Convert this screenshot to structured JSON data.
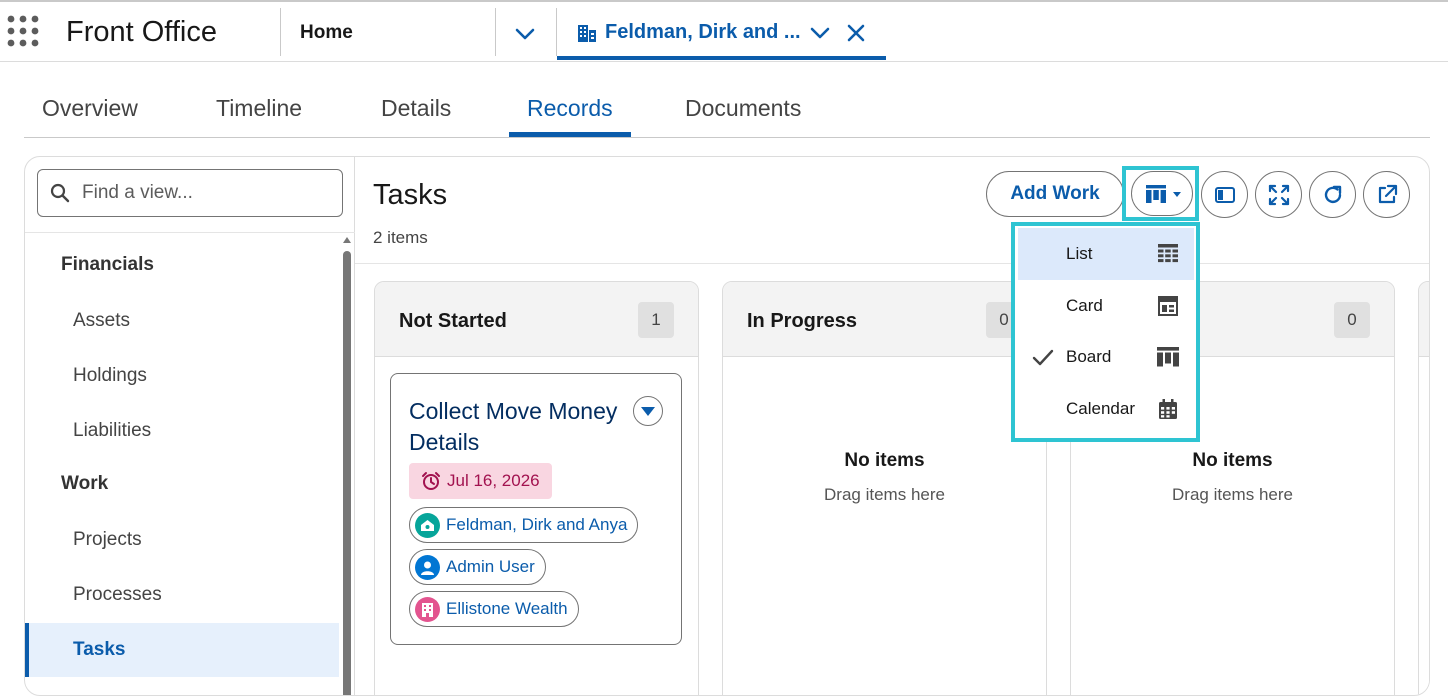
{
  "app": {
    "name": "Front Office",
    "nav_home": "Home",
    "active_tab_label": "Feldman, Dirk and ..."
  },
  "record_tabs": [
    "Overview",
    "Timeline",
    "Details",
    "Records",
    "Documents"
  ],
  "active_record_tab": "Records",
  "sidebar": {
    "search_placeholder": "Find a view...",
    "groups": [
      {
        "label": "Financials",
        "items": [
          "Assets",
          "Holdings",
          "Liabilities"
        ]
      },
      {
        "label": "Work",
        "items": [
          "Projects",
          "Processes",
          "Tasks"
        ]
      }
    ],
    "active_item": "Tasks"
  },
  "content": {
    "title": "Tasks",
    "count_label": "2 items",
    "add_button": "Add Work"
  },
  "columns": [
    {
      "title": "Not Started",
      "count": "1"
    },
    {
      "title": "In Progress",
      "count": "0",
      "empty_title": "No items",
      "empty_sub": "Drag items here"
    },
    {
      "title": "",
      "count": "0",
      "empty_title": "No items",
      "empty_sub": "Drag items here"
    }
  ],
  "task_card": {
    "title": "Collect Move Money Details",
    "due_date": "Jul 16, 2026",
    "related": [
      {
        "label": "Feldman, Dirk and Anya",
        "icon": "household-icon",
        "color": "#06a59a"
      },
      {
        "label": "Admin User",
        "icon": "user-icon",
        "color": "#0176d3"
      },
      {
        "label": "Ellistone Wealth",
        "icon": "building-icon",
        "color": "#e3548f"
      }
    ]
  },
  "view_menu": {
    "items": [
      {
        "label": "List",
        "icon": "list-grid-icon",
        "checked": false,
        "highlighted": true
      },
      {
        "label": "Card",
        "icon": "card-layout-icon",
        "checked": false,
        "highlighted": false
      },
      {
        "label": "Board",
        "icon": "kanban-icon",
        "checked": true,
        "highlighted": false
      },
      {
        "label": "Calendar",
        "icon": "calendar-icon",
        "checked": false,
        "highlighted": false
      }
    ]
  },
  "colors": {
    "brand": "#0b5cab",
    "focus_outline": "#2ec4d2",
    "due_bg": "#f9d6e1",
    "due_text": "#a2124f"
  }
}
